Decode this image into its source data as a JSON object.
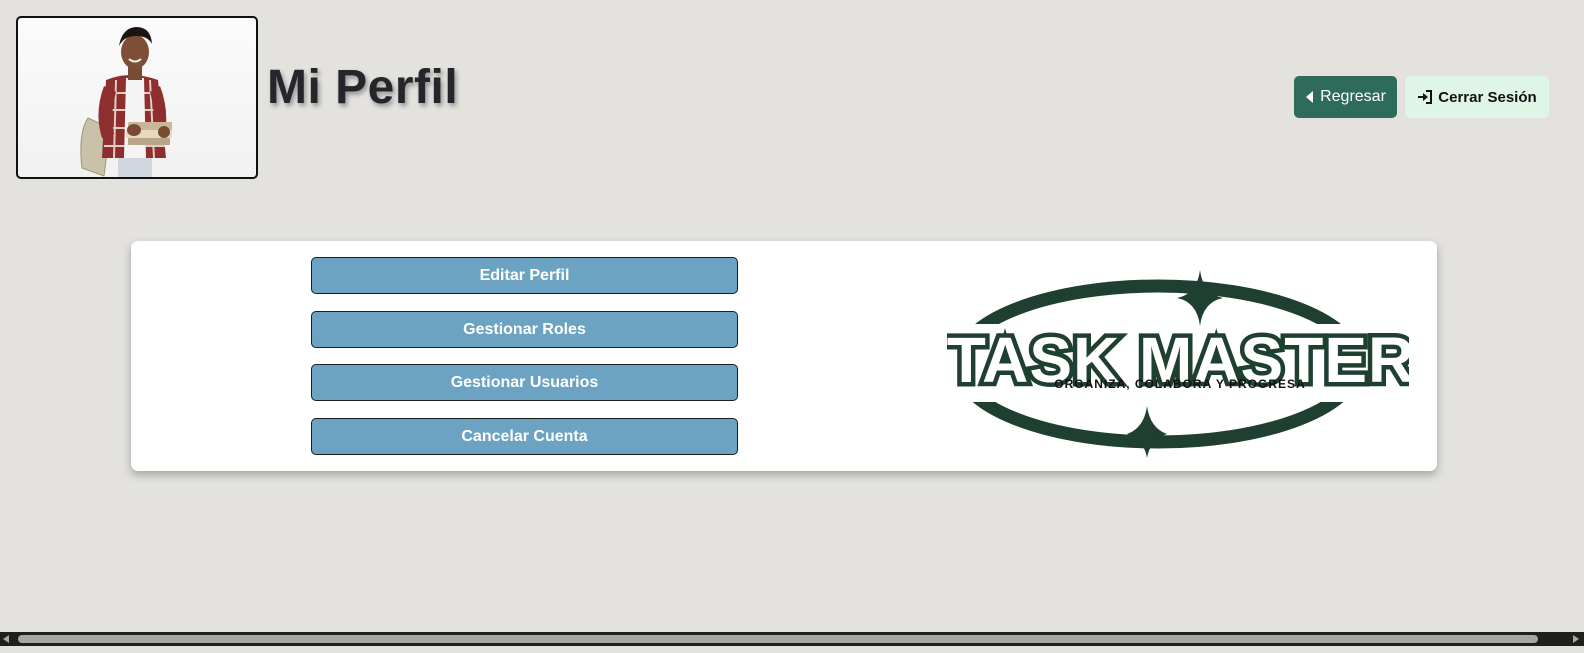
{
  "header": {
    "title": "Mi Perfil",
    "back_label": "Regresar",
    "back_icon": "caret-left-icon",
    "logout_label": "Cerrar Sesión",
    "logout_icon": "sign-in-icon"
  },
  "profile": {
    "avatar_icon": "profile-photo"
  },
  "menu": {
    "items": [
      {
        "label": "Editar Perfil"
      },
      {
        "label": "Gestionar Roles"
      },
      {
        "label": "Gestionar Usuarios"
      },
      {
        "label": "Cancelar Cuenta"
      }
    ]
  },
  "logo": {
    "title": "TASK MASTER",
    "tagline": "ORGANIZA, COLABORA Y PROGRESA"
  },
  "colors": {
    "background": "#e3e2de",
    "back_button": "#2e6b5b",
    "logout_button": "#dff5e6",
    "menu_button": "#6ca3c2",
    "logo_green": "#1f4030"
  }
}
